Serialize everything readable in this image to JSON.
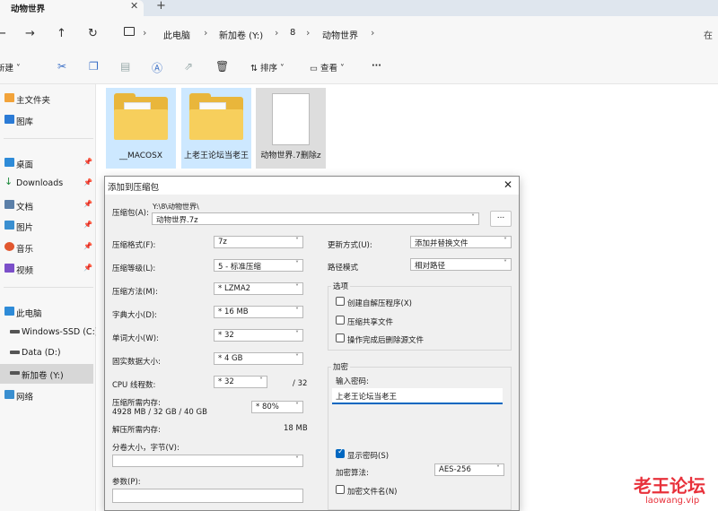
{
  "tabs": {
    "active_title": "动物世界",
    "close_icon": "close-icon",
    "new_tab": "+"
  },
  "addressbar": {
    "crumbs": [
      "此电脑",
      "新加卷 (Y:)",
      "8",
      "动物世界"
    ],
    "search_placeholder": "在"
  },
  "toolbar": {
    "new_label": "新建",
    "sort_label": "排序",
    "view_label": "查看",
    "more_label": "···"
  },
  "sidebar": {
    "items": [
      {
        "label": "主文件夹",
        "pinned": false
      },
      {
        "label": "图库",
        "pinned": false
      },
      {
        "label": "桌面",
        "pinned": true
      },
      {
        "label": "Downloads",
        "pinned": true
      },
      {
        "label": "文档",
        "pinned": true
      },
      {
        "label": "图片",
        "pinned": true
      },
      {
        "label": "音乐",
        "pinned": true
      },
      {
        "label": "视频",
        "pinned": true
      },
      {
        "label": "此电脑",
        "pinned": false
      },
      {
        "label": "Windows-SSD (C:)",
        "pinned": false
      },
      {
        "label": "Data (D:)",
        "pinned": false
      },
      {
        "label": "新加卷 (Y:)",
        "pinned": false,
        "selected": true
      },
      {
        "label": "网络",
        "pinned": false
      }
    ]
  },
  "files": [
    {
      "name": "__MACOSX",
      "type": "folder"
    },
    {
      "name": "上老王论坛当老王",
      "type": "folder"
    },
    {
      "name": "动物世界.7删除z",
      "type": "file"
    }
  ],
  "dialog": {
    "title": "添加到压缩包",
    "archive_label": "压缩包(A):",
    "archive_path": "Y:\\8\\动物世界\\",
    "archive_name": "动物世界.7z",
    "browse_label": "...",
    "format_label": "压缩格式(F):",
    "format_value": "7z",
    "level_label": "压缩等级(L):",
    "level_value": "5 - 标准压缩",
    "method_label": "压缩方法(M):",
    "method_value": "* LZMA2",
    "dict_label": "字典大小(D):",
    "dict_value": "* 16 MB",
    "word_label": "单词大小(W):",
    "word_value": "* 32",
    "solid_label": "固实数据大小:",
    "solid_value": "* 4 GB",
    "threads_label": "CPU 线程数:",
    "threads_value": "* 32",
    "threads_max": "/ 32",
    "mem_label": "压缩所需内存:",
    "mem_detail": "4928 MB / 32 GB / 40 GB",
    "mem_value": "* 80%",
    "decomp_label": "解压所需内存:",
    "decomp_value": "18 MB",
    "split_label": "分卷大小，字节(V):",
    "split_value": "",
    "params_label": "参数(P):",
    "params_value": "",
    "update_label": "更新方式(U):",
    "update_value": "添加并替换文件",
    "path_label": "路径模式",
    "path_value": "相对路径",
    "options_title": "选项",
    "opt_sfx": "创建自解压程序(X)",
    "opt_shared": "压缩共享文件",
    "opt_delete": "操作完成后删除源文件",
    "enc_title": "加密",
    "pwd_label": "输入密码:",
    "pwd_value": "上老王论坛当老王",
    "show_pwd": "显示密码(S)",
    "enc_method_label": "加密算法:",
    "enc_method_value": "AES-256",
    "enc_names": "加密文件名(N)"
  },
  "watermark": {
    "text": "老王论坛",
    "url": "laowang.vip"
  },
  "colors": {
    "accent": "#0067c0",
    "folder": "#f7cf5c",
    "selection": "#cde8ff",
    "watermark": "#e8313b"
  }
}
